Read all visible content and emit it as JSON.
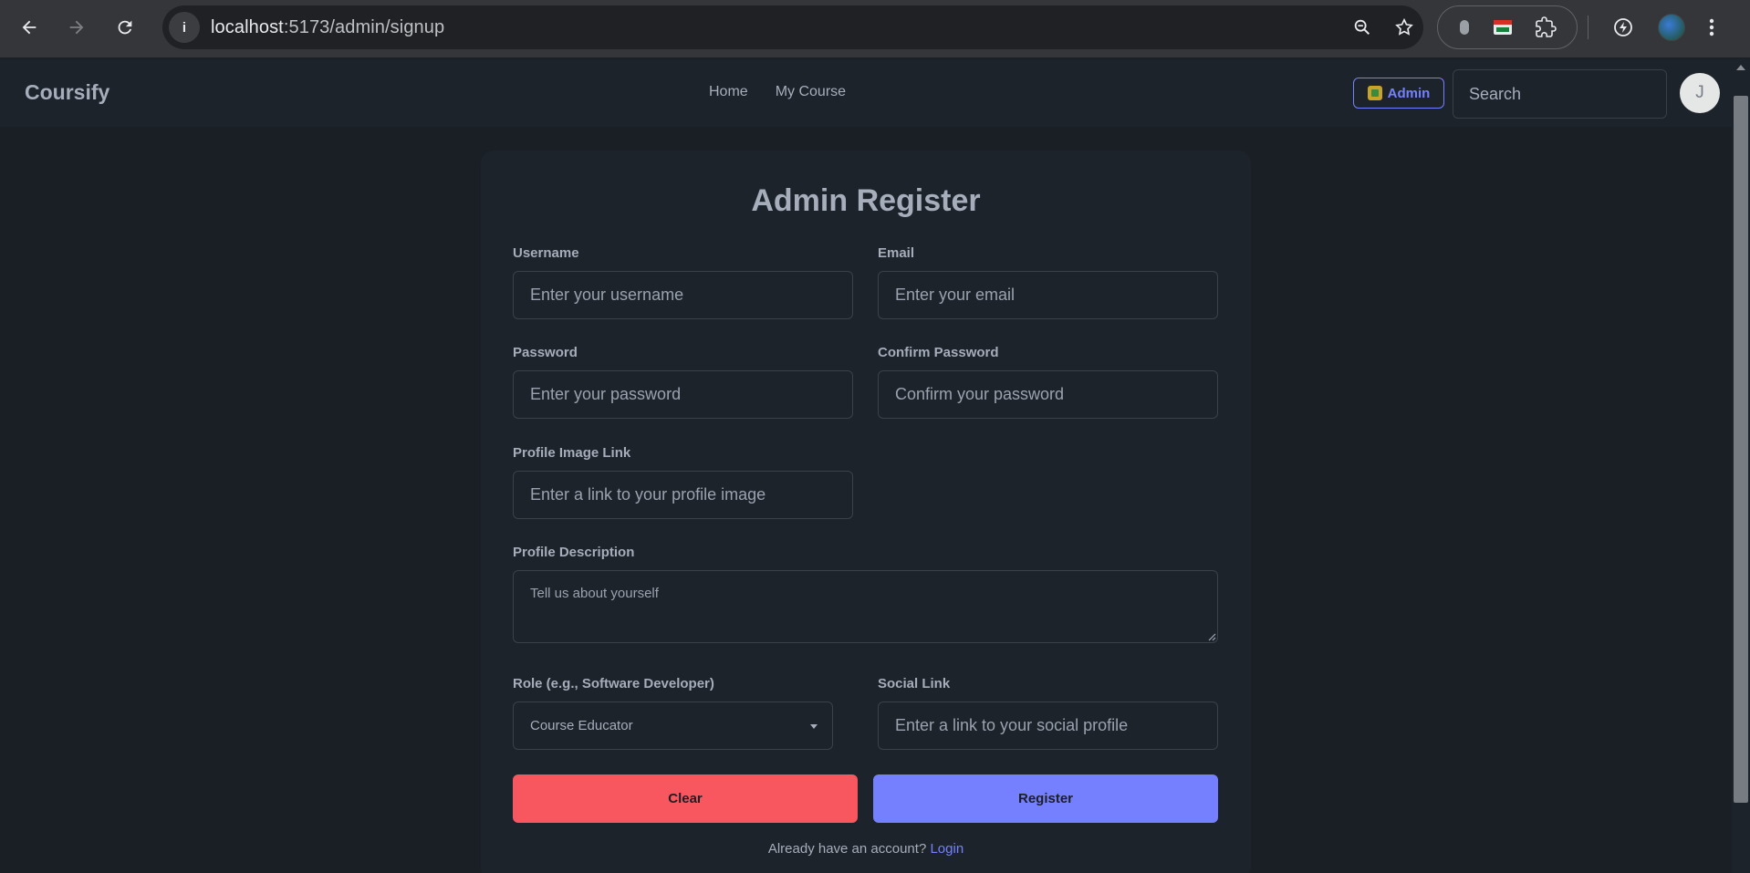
{
  "browser": {
    "url_host": "localhost",
    "url_path": ":5173/admin/signup"
  },
  "navbar": {
    "brand": "Coursify",
    "links": [
      "Home",
      "My Course"
    ],
    "admin_label": "Admin",
    "search_placeholder": "Search",
    "avatar_initial": "J"
  },
  "form": {
    "title": "Admin Register",
    "username": {
      "label": "Username",
      "placeholder": "Enter your username"
    },
    "email": {
      "label": "Email",
      "placeholder": "Enter your email"
    },
    "password": {
      "label": "Password",
      "placeholder": "Enter your password"
    },
    "confirm_password": {
      "label": "Confirm Password",
      "placeholder": "Confirm your password"
    },
    "profile_image": {
      "label": "Profile Image Link",
      "placeholder": "Enter a link to your profile image"
    },
    "profile_description": {
      "label": "Profile Description",
      "placeholder": "Tell us about yourself"
    },
    "role": {
      "label": "Role (e.g., Software Developer)",
      "selected": "Course Educator"
    },
    "social_link": {
      "label": "Social Link",
      "placeholder": "Enter a link to your social profile"
    },
    "clear_label": "Clear",
    "register_label": "Register",
    "footer_prompt": "Already have an account?",
    "login_label": "Login"
  },
  "colors": {
    "primary": "#7480ff",
    "error": "#f8575f",
    "base": "#1d232a"
  }
}
